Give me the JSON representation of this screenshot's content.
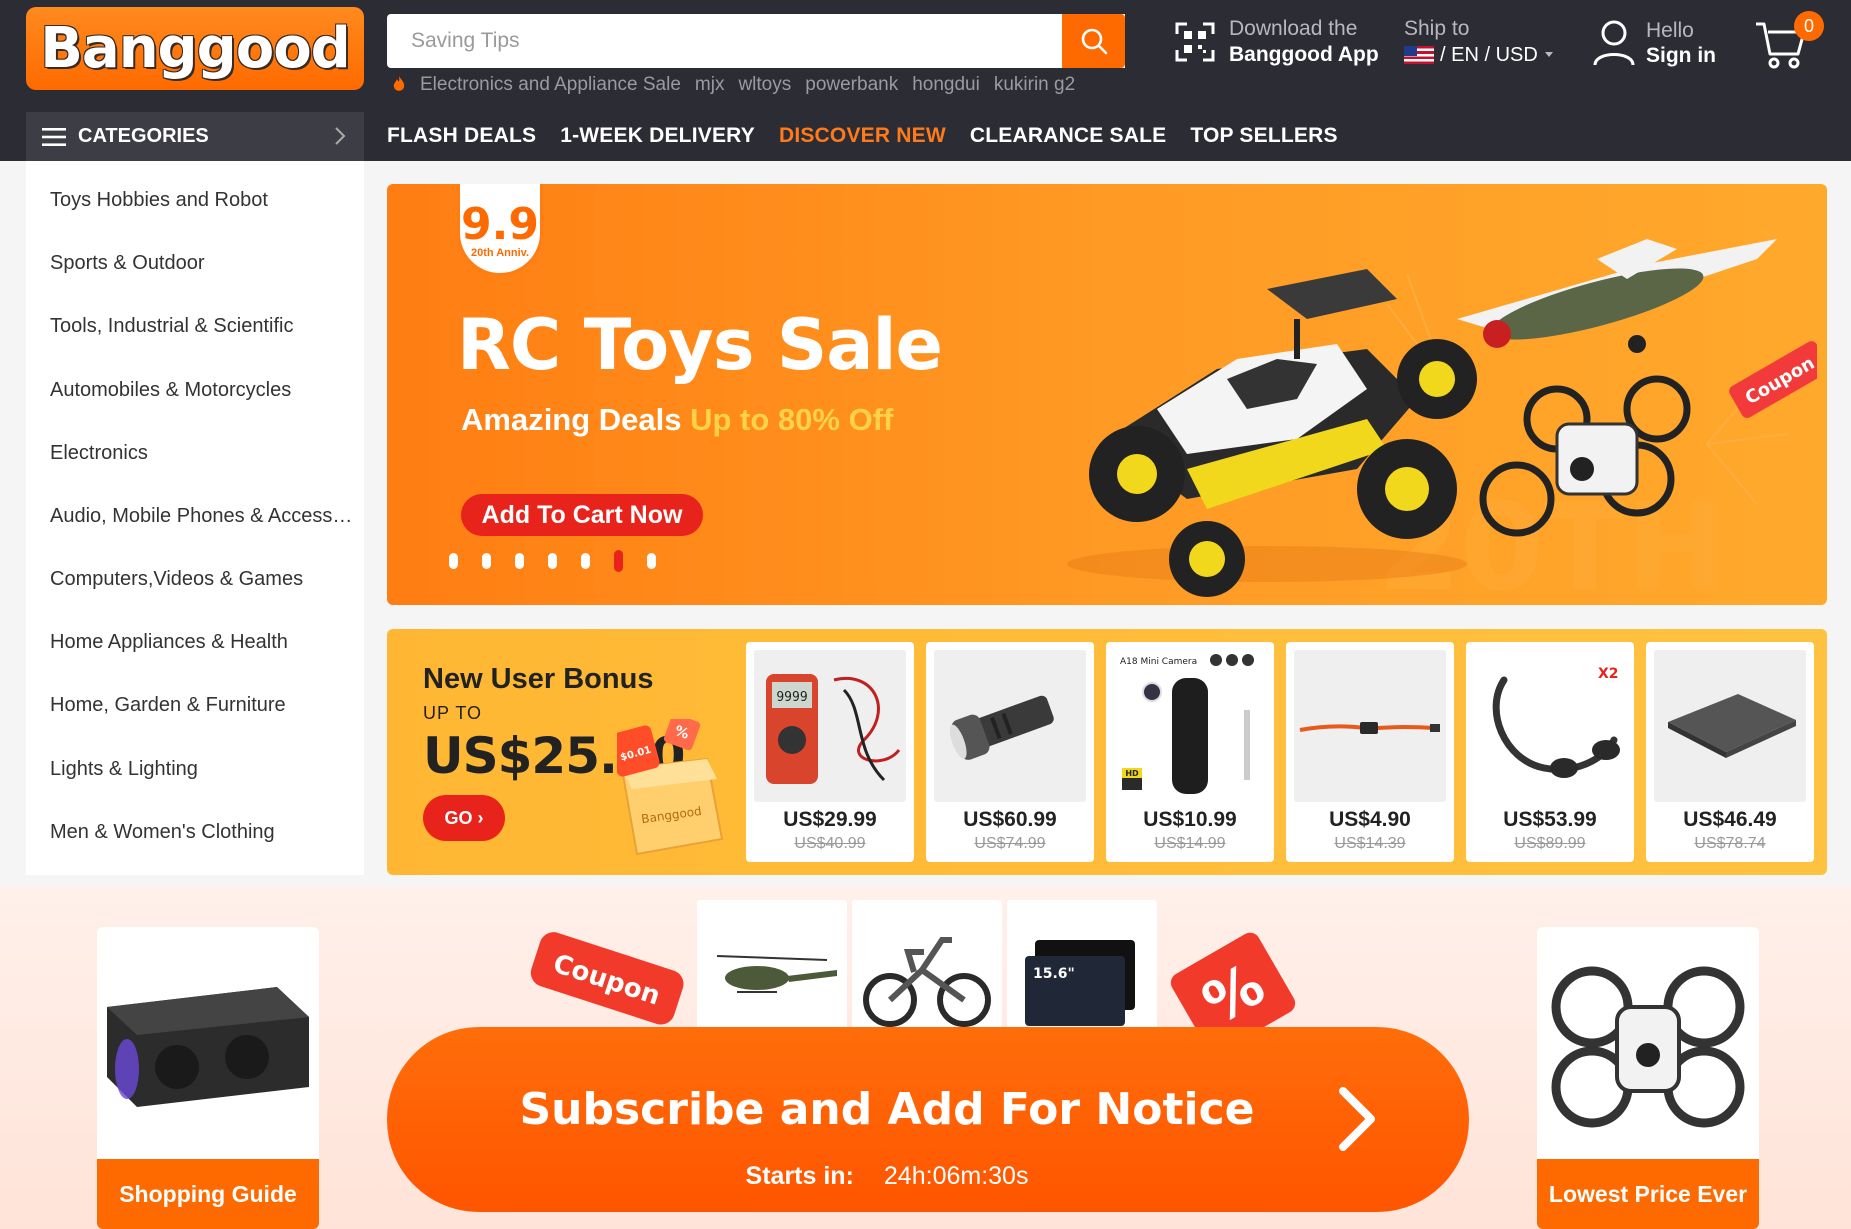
{
  "header": {
    "logo": "Banggood",
    "search_placeholder": "Saving Tips",
    "hot_words": [
      "Electronics and Appliance Sale",
      "mjx",
      "wltoys",
      "powerbank",
      "hongdui",
      "kukirin g2"
    ],
    "app_line1": "Download the",
    "app_line2": "Banggood App",
    "ship_line1": "Ship to",
    "ship_line2": "/ EN / USD",
    "signin_line1": "Hello",
    "signin_line2": "Sign in",
    "cart_count": "0"
  },
  "nav": {
    "categories_label": "CATEGORIES",
    "links": [
      "FLASH DEALS",
      "1-WEEK DELIVERY",
      "DISCOVER NEW",
      "CLEARANCE SALE",
      "TOP SELLERS"
    ]
  },
  "sidebar": {
    "items": [
      "Toys Hobbies and Robot",
      "Sports & Outdoor",
      "Tools, Industrial & Scientific",
      "Automobiles & Motorcycles",
      "Electronics",
      "Audio, Mobile Phones & Accessories",
      "Computers,Videos & Games",
      "Home Appliances & Health",
      "Home, Garden & Furniture",
      "Lights & Lighting",
      "Men & Women's Clothing"
    ]
  },
  "hero": {
    "badge_number": "9.9",
    "badge_sub": "20th Anniv.",
    "title": "RC Toys Sale",
    "subtitle_white": "Amazing Deals ",
    "subtitle_yellow": "Up to 80% Off",
    "cta": "Add To Cart Now",
    "coupon_tag": "Coupon",
    "slide_count": 7,
    "active_slide": 6
  },
  "bonus": {
    "heading": "New User Bonus",
    "upto": "UP TO",
    "amount": "US$25.00",
    "go": "GO ›",
    "gift_label": "Banggood",
    "gift_coupon": "$0.01",
    "products": [
      {
        "price": "US$29.99",
        "old": "US$40.99"
      },
      {
        "price": "US$60.99",
        "old": "US$74.99"
      },
      {
        "price": "US$10.99",
        "old": "US$14.99",
        "tag": "A18 Mini Camera",
        "hd": "HD"
      },
      {
        "price": "US$4.90",
        "old": "US$14.39"
      },
      {
        "price": "US$53.99",
        "old": "US$89.99",
        "tag": "X2"
      },
      {
        "price": "US$46.49",
        "old": "US$78.74"
      }
    ]
  },
  "promo": {
    "left_card": "Shopping Guide",
    "right_card": "Lowest Price Ever",
    "coupon_tag": "Coupon",
    "percent_tag": "%",
    "subscribe": "Subscribe and Add For Notice",
    "starts_label": "Starts in:",
    "countdown": "24h:06m:30s",
    "tablet_size": "15.6\""
  },
  "colors": {
    "accent": "#ff6a00",
    "header_bg": "#2c2c34",
    "nav_active": "#ff7a1a",
    "cta_red": "#e8231c"
  }
}
